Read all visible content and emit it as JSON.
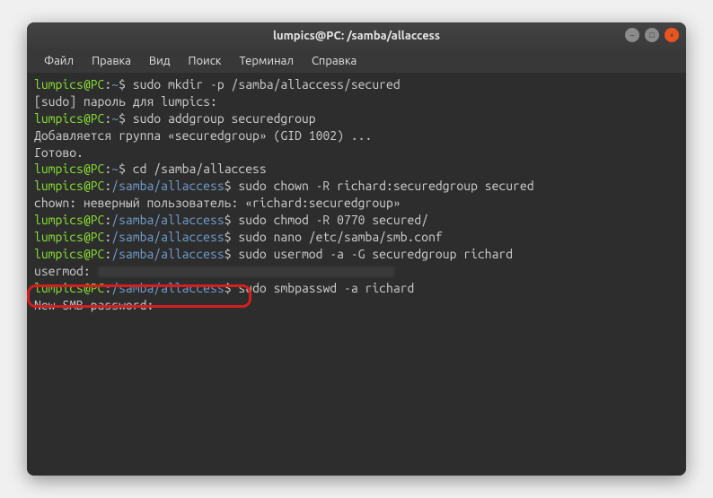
{
  "window": {
    "title": "lumpics@PC: /samba/allaccess"
  },
  "menus": {
    "file": "Файл",
    "edit": "Правка",
    "view": "Вид",
    "search": "Поиск",
    "terminal": "Терминал",
    "help": "Справка"
  },
  "prompt": {
    "user": "lumpics@PC",
    "home": "~",
    "cwd": "/samba/allaccess",
    "dollar": "$"
  },
  "lines": {
    "l1_cmd": " sudo mkdir -p /samba/allaccess/secured",
    "l2": "[sudo] пароль для lumpics:",
    "l3_cmd": " sudo addgroup securedgroup",
    "l4": "Добавляется группа «securedgroup» (GID 1002) ...",
    "l5": "Готово.",
    "l6_cmd": " cd /samba/allaccess",
    "l7_cmd": " sudo chown -R richard:securedgroup secured",
    "l8": "chown: неверный пользователь: «richard:securedgroup»",
    "l9_cmd": " sudo chmod -R 0770 secured/",
    "l10_cmd": " sudo nano /etc/samba/smb.conf",
    "l11_cmd": " sudo usermod -a -G securedgroup richard",
    "l12": "usermod: ",
    "l13_cmd": " sudo smbpasswd -a richard",
    "l14": "New SMB password:"
  },
  "highlight": {
    "target": "New SMB password:"
  }
}
